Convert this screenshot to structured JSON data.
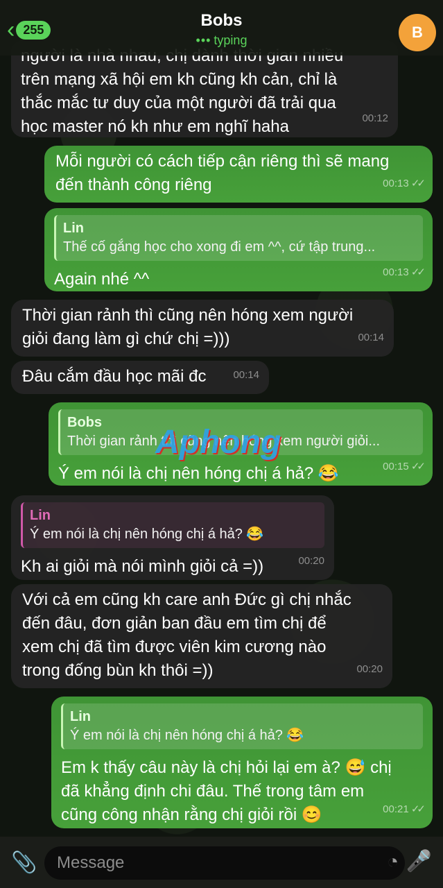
{
  "header": {
    "back_count": "255",
    "title": "Bobs",
    "status": "typing",
    "avatar_letter": "B",
    "accent": "#5ad35a",
    "avatar_color": "#f3a23a"
  },
  "messages": [
    {
      "side": "in",
      "text": "người là nhà nhau, chị dành thời gian nhiều\ntrên mạng xã hội em kh cũng kh cản, chỉ là\nthắc mắc tư duy của một người đã trải qua\nhọc master nó kh như em nghĩ haha",
      "time": "00:12"
    },
    {
      "side": "out",
      "text": "Mỗi người có cách tiếp cận riêng thì sẽ mang\nđến thành công riêng",
      "time": "00:13"
    },
    {
      "side": "out",
      "quote_name": "Lin",
      "quote_text": "Thế cố gắng học cho xong đi em ^^, cứ tập trung...",
      "text": "Again nhé ^^",
      "time": "00:13"
    },
    {
      "side": "in",
      "text": "Thời gian rảnh thì cũng nên hóng xem người\ngiỏi đang làm gì chứ chị =)))",
      "time": "00:14"
    },
    {
      "side": "in",
      "text": "Đâu cắm đầu học mãi đc",
      "time": "00:14"
    },
    {
      "side": "out",
      "quote_name": "Bobs",
      "quote_text": "Thời gian rảnh thì cũng nên hóng xem người giỏi...",
      "text": "Ý em nói là chị nên hóng chị á hả? 😂",
      "time": "00:15"
    },
    {
      "side": "in",
      "quote_name": "Lin",
      "quote_text": "Ý em nói là chị nên hóng chị á hả? 😂",
      "text": "Kh ai giỏi mà nói mình giỏi cả =))",
      "time": "00:20"
    },
    {
      "side": "in",
      "text": "Với cả em cũng kh care anh Đức gì chị nhắc\nđến đâu, đơn giản ban đầu em tìm chị để\nxem chị đã tìm được viên kim cương nào\ntrong đống bùn kh thôi =))",
      "time": "00:20"
    },
    {
      "side": "out",
      "quote_name": "Lin",
      "quote_text": "Ý em nói là chị nên hóng chị á hả? 😂",
      "text": "Em k thấy câu này là chị hỏi lại em à? 😅 chị\nđã khẳng định chi đâu. Thế trong tâm em\ncũng công nhận rằng chị giỏi rồi 😊",
      "time": "00:21"
    }
  ],
  "watermark": "Aphong",
  "composer": {
    "placeholder": "Message",
    "attach_icon": "paperclip-icon",
    "sticker_icon": "sticker-icon",
    "mic_icon": "microphone-icon"
  }
}
